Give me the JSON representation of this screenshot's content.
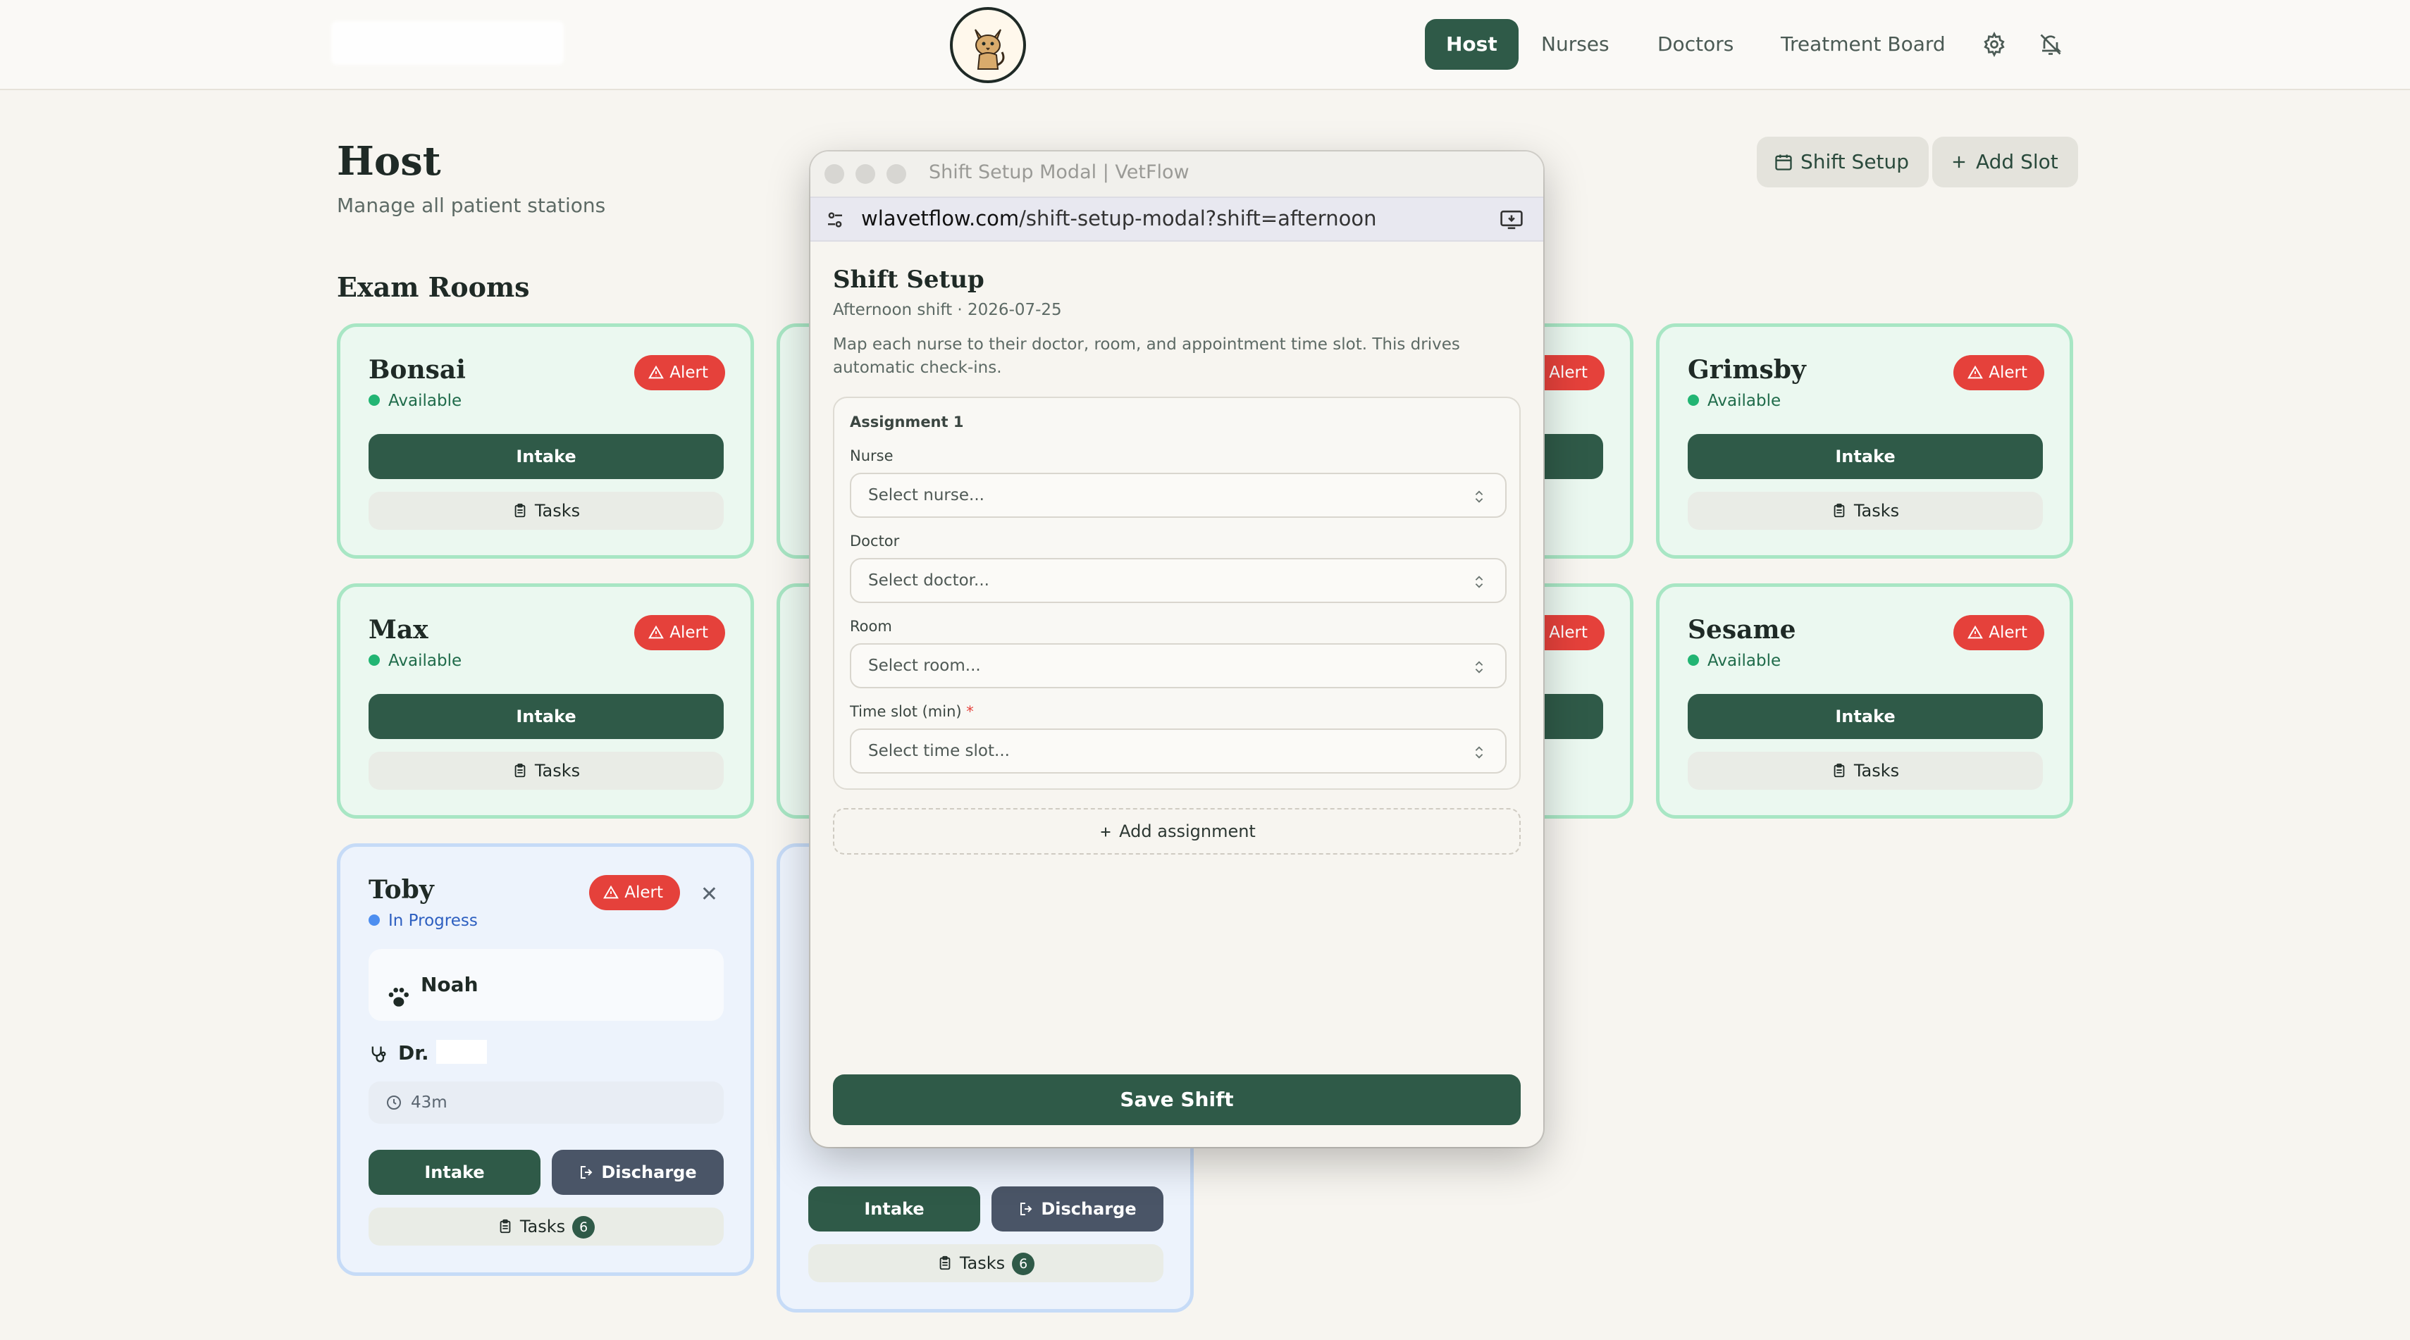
{
  "nav": {
    "items": [
      {
        "label": "Host",
        "active": true
      },
      {
        "label": "Nurses",
        "active": false
      },
      {
        "label": "Doctors",
        "active": false
      },
      {
        "label": "Treatment Board",
        "active": false
      }
    ],
    "icons": [
      "gear-icon",
      "bell-off-icon"
    ]
  },
  "page": {
    "title": "Host",
    "subtitle": "Manage all patient stations",
    "section": "Exam Rooms",
    "shift_setup_label": "Shift Setup",
    "add_slot_label": "Add Slot"
  },
  "cards": [
    {
      "name": "Bonsai",
      "status": "Available",
      "alert": "Alert",
      "intake": "Intake",
      "tasks": "Tasks"
    },
    {
      "name": "Grimsby",
      "status": "Available",
      "alert": "Alert",
      "intake": "Intake",
      "tasks": "Tasks"
    },
    {
      "name": "Max",
      "status": "Available",
      "alert": "Alert",
      "intake": "Intake",
      "tasks": "Tasks"
    },
    {
      "name": "Sesame",
      "status": "Available",
      "alert": "Alert",
      "intake": "Intake",
      "tasks": "Tasks"
    },
    {
      "name": "Toby",
      "status": "In Progress",
      "alert": "Alert",
      "patient": "Noah",
      "doctor": "Dr.",
      "elapsed": "43m",
      "intake": "Intake",
      "discharge": "Discharge",
      "tasks": "Tasks",
      "task_count": "6"
    },
    {
      "name": "",
      "status": "",
      "intake": "Intake",
      "discharge": "Discharge",
      "tasks": "Tasks",
      "task_count": "6"
    }
  ],
  "hidden_card_alerts": [
    "Alert",
    "Alert"
  ],
  "modal": {
    "window_title": "Shift Setup Modal | VetFlow",
    "url_domain": "wlavetflow.com",
    "url_path": "/shift-setup-modal?shift=afternoon",
    "title": "Shift Setup",
    "subtitle": "Afternoon shift · 2026-07-25",
    "description": "Map each nurse to their doctor, room, and appointment time slot. This drives automatic check-ins.",
    "assignment_title": "Assignment 1",
    "fields": [
      {
        "label": "Nurse",
        "placeholder": "Select nurse...",
        "required": false
      },
      {
        "label": "Doctor",
        "placeholder": "Select doctor...",
        "required": false
      },
      {
        "label": "Room",
        "placeholder": "Select room...",
        "required": false
      },
      {
        "label": "Time slot (min)",
        "placeholder": "Select time slot...",
        "required": true
      }
    ],
    "required_mark": "*",
    "add_assignment": "Add assignment",
    "save": "Save Shift"
  },
  "colors": {
    "primary": "#2f5a48",
    "alert": "#e5413b",
    "available_border": "#a8e6c4",
    "in_progress_border": "#c6dbf7",
    "discharge": "#4a5567"
  }
}
